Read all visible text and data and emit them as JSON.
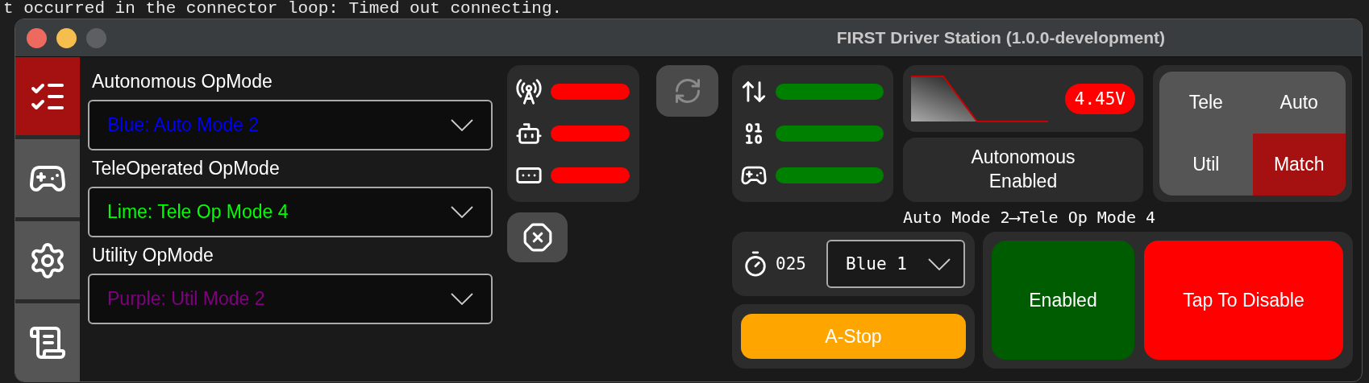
{
  "terminal": {
    "lines": [
      "t occurred in the connector loop: Timed out connecting."
    ]
  },
  "window": {
    "title": "FIRST Driver Station (1.0.0-development)"
  },
  "sidebar": {
    "items": [
      {
        "kind": "checklist",
        "selected": true
      },
      {
        "kind": "gamepad",
        "selected": false
      },
      {
        "kind": "settings",
        "selected": false
      },
      {
        "kind": "log",
        "selected": false
      }
    ]
  },
  "opmodes": [
    {
      "label": "Autonomous OpMode",
      "value": "Blue: Auto Mode 2",
      "color": "#0000ff"
    },
    {
      "label": "TeleOperated OpMode",
      "value": "Lime: Tele Op Mode 4",
      "color": "#00ff00"
    },
    {
      "label": "Utility OpMode",
      "value": "Purple: Util Mode 2",
      "color": "#800080"
    }
  ],
  "status_lights": [
    {
      "kind": "radio",
      "color": "#ff0000"
    },
    {
      "kind": "robot",
      "color": "#ff0000"
    },
    {
      "kind": "terminal",
      "color": "#ff0000"
    }
  ],
  "connection_lights": [
    {
      "kind": "transfer",
      "color": "#008000"
    },
    {
      "kind": "binary",
      "color": "#008000"
    },
    {
      "kind": "gamepad",
      "color": "#008000"
    }
  ],
  "battery": {
    "reading": "4.45V"
  },
  "status": {
    "text": "Autonomous Enabled"
  },
  "modes": [
    {
      "label": "Tele",
      "selected": false
    },
    {
      "label": "Auto",
      "selected": false
    },
    {
      "label": "Util",
      "selected": false
    },
    {
      "label": "Match",
      "selected": true
    }
  ],
  "transition": "Auto Mode 2⟶Tele Op Mode 4",
  "timer": "025",
  "station": "Blue 1",
  "astop": "A-Stop",
  "enable_buttons": [
    {
      "label": "Enabled",
      "kind": "enable"
    },
    {
      "label": "Tap To Disable",
      "kind": "disable"
    }
  ]
}
